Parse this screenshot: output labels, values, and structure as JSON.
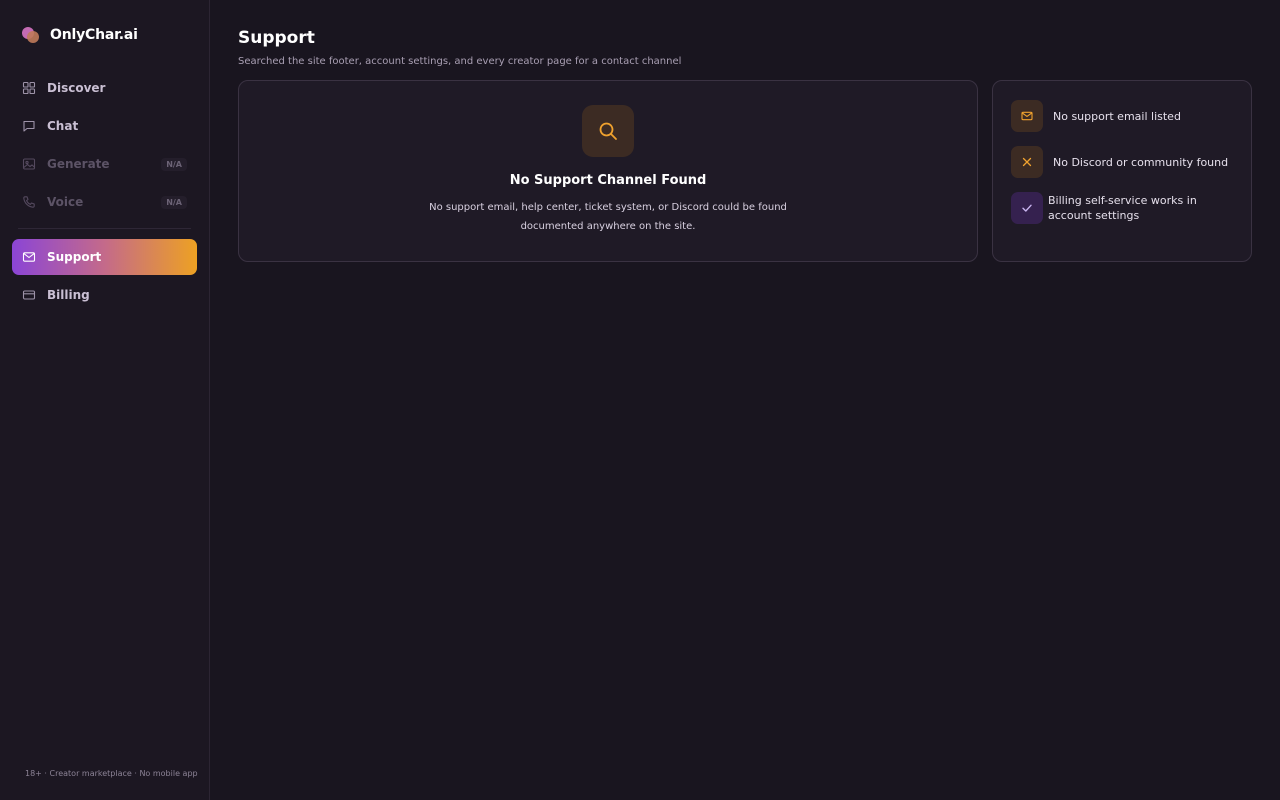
{
  "brand": {
    "name": "OnlyChar.ai"
  },
  "nav": {
    "items": [
      {
        "label": "Discover",
        "icon": "grid-icon"
      },
      {
        "label": "Chat",
        "icon": "chat-bubble-icon"
      },
      {
        "label": "Generate",
        "icon": "image-icon",
        "badge": "N/A",
        "disabled": true
      },
      {
        "label": "Voice",
        "icon": "phone-icon",
        "badge": "N/A",
        "disabled": true
      },
      {
        "label": "Support",
        "icon": "mail-icon",
        "active": true
      },
      {
        "label": "Billing",
        "icon": "credit-card-icon"
      }
    ]
  },
  "sidebar_footer": "18+ · Creator marketplace · No mobile app",
  "page": {
    "title": "Support",
    "subtitle": "Searched the site footer, account settings, and every creator page for a contact channel"
  },
  "empty_state": {
    "icon": "search-icon",
    "title": "No Support Channel Found",
    "description": "No support email, help center, ticket system, or Discord could be found documented anywhere on the site."
  },
  "status_list": [
    {
      "icon": "mail-icon",
      "label": "No support email listed",
      "state": "warning"
    },
    {
      "icon": "x-icon",
      "label": "No Discord or community found",
      "state": "warning"
    },
    {
      "icon": "check-icon",
      "label": "Billing self-service works in account settings",
      "state": "ok"
    }
  ],
  "colors": {
    "background": "#19151f",
    "sidebar": "#1c1722",
    "card": "#1f1a26",
    "accent_purple": "#8b45d6",
    "accent_orange": "#eda123",
    "warning_icon": "#f0a22e",
    "ok_icon": "#c9b4f0"
  }
}
